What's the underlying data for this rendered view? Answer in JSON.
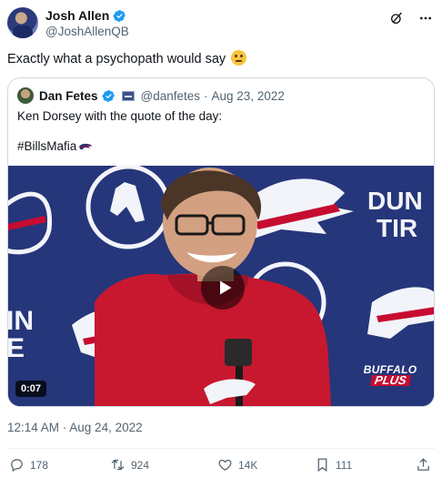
{
  "author": {
    "name": "Josh Allen",
    "handle": "@JoshAllenQB"
  },
  "tweet": {
    "text": "Exactly what a psychopath would say",
    "emoji": "thinking-face"
  },
  "quoted": {
    "author_name": "Dan Fetes",
    "author_handle": "@danfetes",
    "separator": "·",
    "date": "Aug 23, 2022",
    "line1": "Ken Dorsey with the quote of the day:",
    "hashtag": "#BillsMafia",
    "video": {
      "duration": "0:07",
      "brand_line1": "BUFFALO",
      "brand_line2": "PLUS"
    }
  },
  "timestamp": "12:14 AM · Aug 24, 2022",
  "actions": {
    "replies": "178",
    "reposts": "924",
    "likes": "14K",
    "bookmarks": "111"
  },
  "colors": {
    "verified": "#1d9bf0",
    "bills_blue": "#24326e",
    "bills_red": "#c60c30",
    "secondary_text": "#536471"
  }
}
